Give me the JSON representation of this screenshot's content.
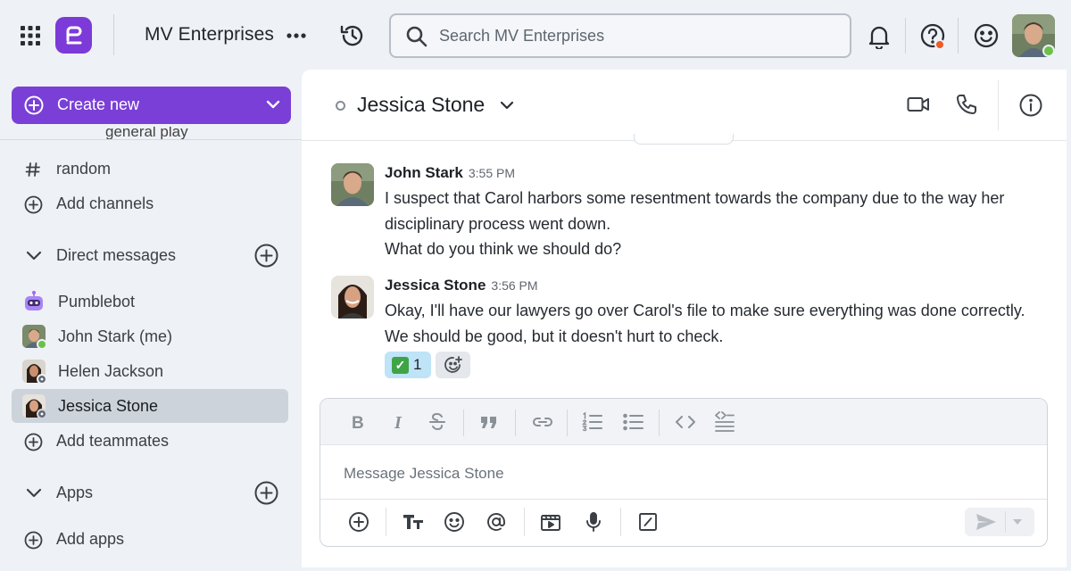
{
  "topbar": {
    "workspace_name": "MV Enterprises",
    "search_placeholder": "Search MV Enterprises"
  },
  "sidebar": {
    "create_label": "Create new",
    "cut_off_item": "general play",
    "channels": [
      {
        "label": "random",
        "icon": "hash-icon"
      },
      {
        "label": "Add channels",
        "icon": "plus-circle-icon"
      }
    ],
    "direct_messages": {
      "section_label": "Direct messages",
      "items": [
        {
          "label": "Pumblebot",
          "status": "none"
        },
        {
          "label": "John Stark (me)",
          "status": "online"
        },
        {
          "label": "Helen Jackson",
          "status": "away"
        },
        {
          "label": "Jessica Stone",
          "status": "away",
          "active": true
        }
      ],
      "add_label": "Add teammates"
    },
    "apps": {
      "section_label": "Apps",
      "add_label": "Add apps"
    }
  },
  "channel": {
    "name": "Jessica Stone"
  },
  "messages": [
    {
      "author": "John Stark",
      "time": "3:55 PM",
      "lines": [
        "I suspect that Carol harbors some resentment towards the company due to the way her",
        "disciplinary process went down.",
        "What do you think we should do?"
      ]
    },
    {
      "author": "Jessica Stone",
      "time": "3:56 PM",
      "lines": [
        "Okay, I'll have our lawyers go over Carol's file to make sure everything was done correctly.",
        "We should be good, but it doesn't hurt to check."
      ],
      "reaction": {
        "emoji": "✓",
        "count": "1"
      }
    }
  ],
  "composer": {
    "placeholder": "Message Jessica Stone"
  },
  "colors": {
    "accent": "#7a3fd6",
    "online": "#6cc04a",
    "notification": "#f05a24",
    "reaction_bg": "#bfe3f7"
  }
}
